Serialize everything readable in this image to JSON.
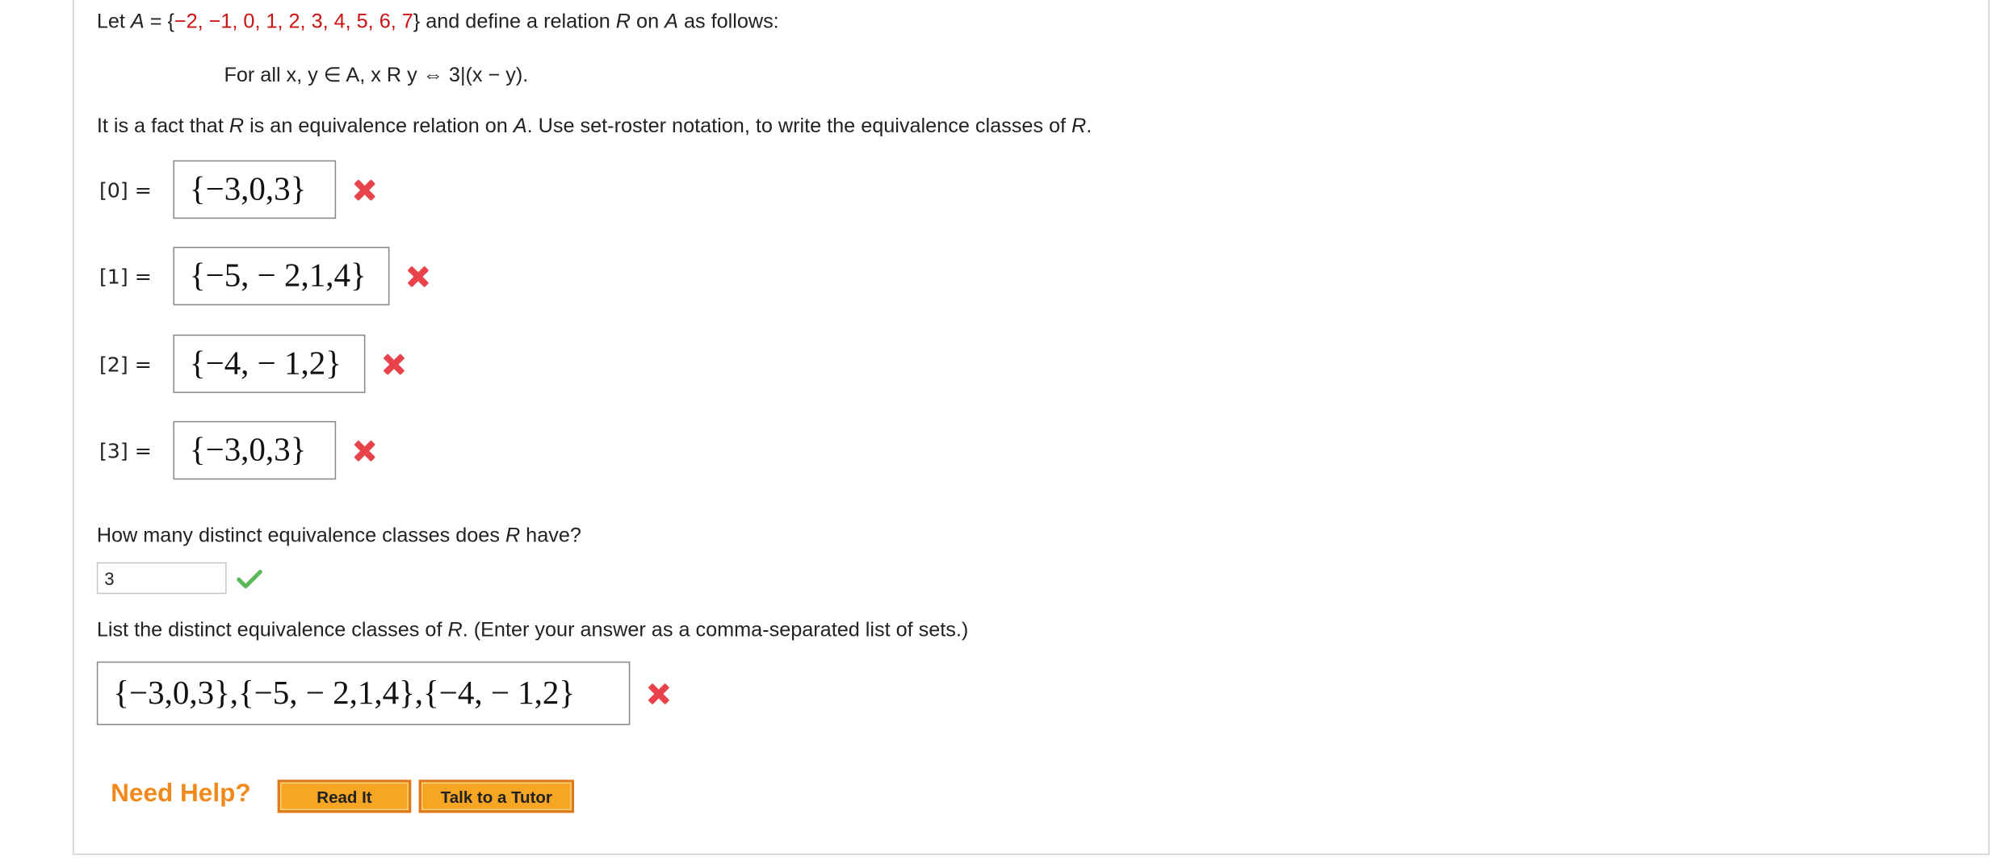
{
  "problem": {
    "intro_prefix": "Let ",
    "intro_var": "A",
    "intro_eq": " = {",
    "set_elements": "−2, −1, 0, 1, 2, 3, 4, 5, 6, 7",
    "intro_suffix_a": "} and define a relation ",
    "intro_R": "R",
    "intro_suffix_b": " on ",
    "intro_A2": "A",
    "intro_suffix_c": " as follows:",
    "rule": "For all x, y ∈ A, x R y ⇔ 3|(x − y).",
    "fact_a": "It is a fact that ",
    "fact_R": "R",
    "fact_b": " is an equivalence relation on ",
    "fact_A": "A",
    "fact_c": ". Use set-roster notation, to write the equivalence classes of ",
    "fact_R2": "R",
    "fact_d": "."
  },
  "classes": [
    {
      "label": "[0] =",
      "answer": "{−3,0,3}",
      "status": "incorrect"
    },
    {
      "label": "[1] =",
      "answer": "{−5, − 2,1,4}",
      "status": "incorrect"
    },
    {
      "label": "[2] =",
      "answer": "{−4, − 1,2}",
      "status": "incorrect"
    },
    {
      "label": "[3] =",
      "answer": "{−3,0,3}",
      "status": "incorrect"
    }
  ],
  "count_question": {
    "text_a": "How many distinct equivalence classes does ",
    "text_R": "R",
    "text_b": " have?",
    "value": "3",
    "status": "correct"
  },
  "list_question": {
    "text_a": "List the distinct equivalence classes of ",
    "text_R": "R",
    "text_b": ". (Enter your answer as a comma-separated list of sets.)",
    "answer": "{−3,0,3},{−5, − 2,1,4},{−4, − 1,2}",
    "status": "incorrect"
  },
  "help": {
    "label": "Need Help?",
    "read_it": "Read It",
    "tutor": "Talk to a Tutor"
  },
  "colors": {
    "set_red": "#cc1111",
    "incorrect": "#e8434a",
    "correct": "#5cb85c",
    "help_orange": "#f08a1c",
    "button_fill": "#f6a623"
  },
  "icons": {
    "incorrect": "x-mark-icon",
    "correct": "check-mark-icon"
  }
}
